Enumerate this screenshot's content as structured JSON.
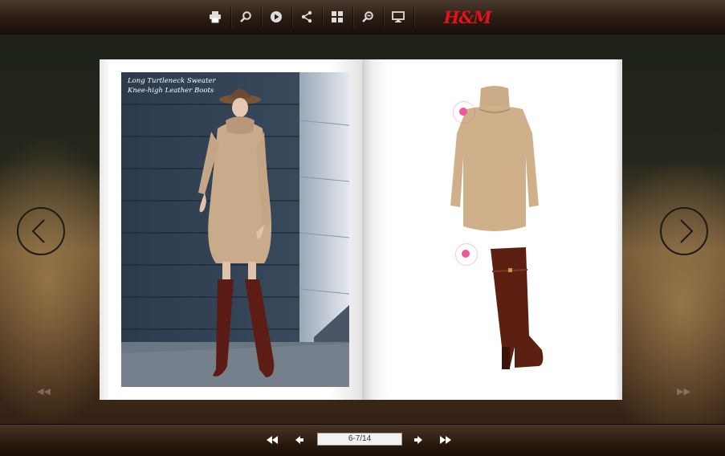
{
  "toolbar": {
    "icons": [
      "print-icon",
      "search-icon",
      "play-icon",
      "share-icon",
      "thumbnails-icon",
      "zoom-icon",
      "fullscreen-icon"
    ],
    "logo_text": "H&M"
  },
  "book": {
    "left_page": {
      "caption_line1": "Long Turtleneck Sweater",
      "caption_line2": "Knee-high Leather Boots"
    }
  },
  "pager": {
    "page_indicator": "6-7/14"
  },
  "colors": {
    "accent": "#e4101a",
    "hotspot": "#f0589a",
    "bar": "#2a1c13"
  }
}
